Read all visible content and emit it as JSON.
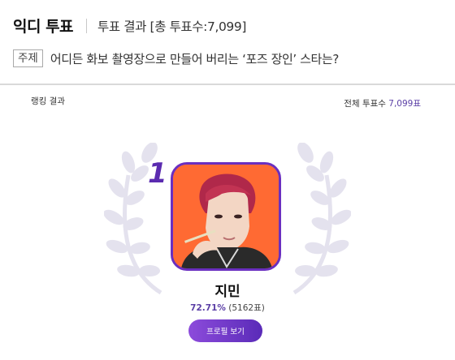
{
  "header": {
    "brand": "익디 투표",
    "subtitle": "투표 결과 [총 투표수:7,099]"
  },
  "topic": {
    "badge": "주제",
    "text": "어디든 화보 촬영장으로 만들어 버리는 ‘포즈 장인’ 스타는?"
  },
  "ranking": {
    "label": "랭킹 결과",
    "total_prefix": "전체 투표수",
    "total_value": "7,099표"
  },
  "winner": {
    "rank": "1",
    "name": "지민",
    "percent": "72.71%",
    "votes": "(5162표)",
    "profile_button": "프로필 보기"
  },
  "colors": {
    "accent": "#5b2bb0",
    "photo_background": "#ff6a33",
    "wreath": "#e4e2ee"
  }
}
